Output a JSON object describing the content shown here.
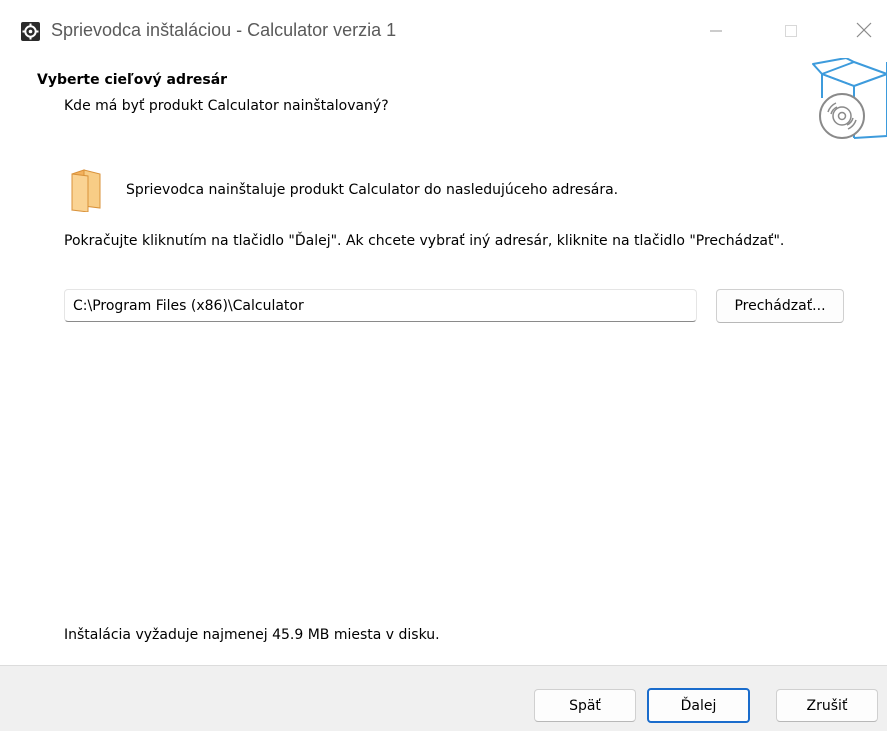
{
  "window": {
    "title": "Sprievodca inštaláciou - Calculator verzia 1",
    "app_icon": "gear-icon",
    "controls": [
      "minimize-icon",
      "maximize-icon",
      "close-icon"
    ]
  },
  "header": {
    "title": "Vyberte cieľový adresár",
    "subtitle": "Kde má byť produkt Calculator nainštalovaný?",
    "image": "install-box-cd-icon"
  },
  "body": {
    "folder_icon": "folder-icon",
    "intro": "Sprievodca nainštaluje produkt Calculator do nasledujúceho adresára.",
    "instruction": "Pokračujte kliknutím na tlačidlo \"Ďalej\". Ak chcete vybrať iný adresár, kliknite na tlačidlo \"Prechádzať\".",
    "path_value": "C:\\Program Files (x86)\\Calculator",
    "browse_label": "Prechádzať...",
    "disk_space": "Inštalácia vyžaduje najmenej 45.9 MB miesta v disku."
  },
  "footer": {
    "back_label": "Späť",
    "next_label": "Ďalej",
    "cancel_label": "Zrušiť"
  },
  "colors": {
    "accent": "#1a6ccc",
    "folder": "#f5c06b",
    "box_outline": "#3d9bdc",
    "footer_bg": "#f0f0f0"
  }
}
